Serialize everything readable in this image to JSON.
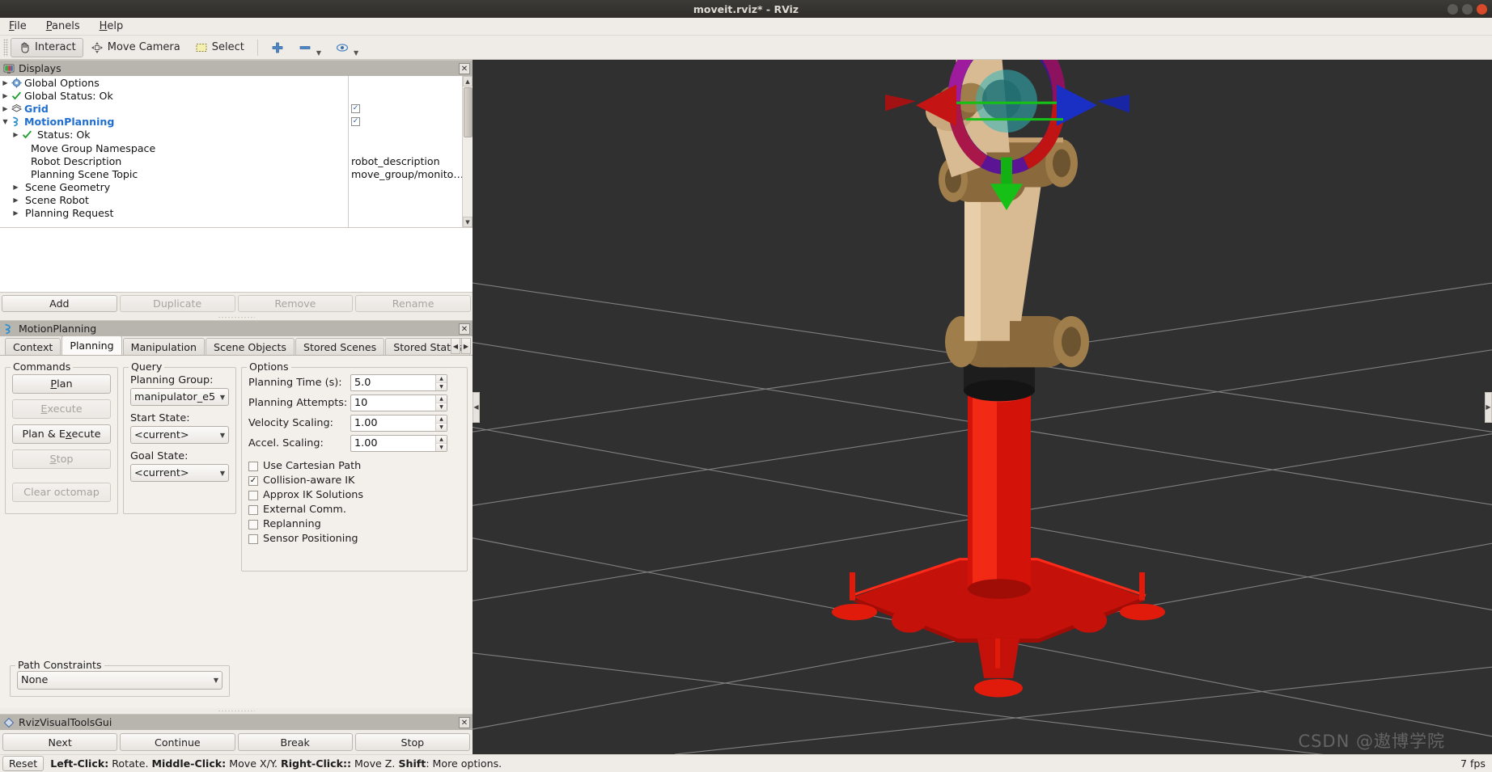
{
  "window": {
    "title": "moveit.rviz* - RViz",
    "buttons": [
      "minimize",
      "maximize",
      "close"
    ]
  },
  "menubar": {
    "items": [
      {
        "label": "File",
        "mnemonic": "F"
      },
      {
        "label": "Panels",
        "mnemonic": "P"
      },
      {
        "label": "Help",
        "mnemonic": "H"
      }
    ]
  },
  "toolbar": {
    "items": [
      {
        "label": "Interact",
        "icon": "hand-cursor-icon",
        "active": true
      },
      {
        "label": "Move Camera",
        "icon": "move-camera-icon",
        "active": false
      },
      {
        "label": "Select",
        "icon": "select-rect-icon",
        "active": false
      }
    ],
    "tools": [
      {
        "label": "",
        "icon": "plus-icon",
        "has_menu": false
      },
      {
        "label": "",
        "icon": "minus-icon",
        "has_menu": true
      },
      {
        "label": "",
        "icon": "eye-focus-icon",
        "has_menu": true
      }
    ]
  },
  "displays_panel": {
    "title": "Displays",
    "icon": "displays-monitor-icon",
    "close_icon": "close-icon",
    "rows": [
      {
        "label": "Global Options",
        "icon": "gear-icon",
        "arrow": "collapsed",
        "indent": 0,
        "bold": false,
        "value": "",
        "checkbox": null
      },
      {
        "label": "Global Status: Ok",
        "icon": "check-icon",
        "arrow": "collapsed",
        "indent": 0,
        "bold": false,
        "value": "",
        "checkbox": null
      },
      {
        "label": "Grid",
        "icon": "grid-icon",
        "arrow": "collapsed",
        "indent": 0,
        "bold": true,
        "value": "",
        "checkbox": true
      },
      {
        "label": "MotionPlanning",
        "icon": "motionplanning-icon",
        "arrow": "expanded",
        "indent": 0,
        "bold": true,
        "value": "",
        "checkbox": true
      },
      {
        "label": "Status: Ok",
        "icon": "check-icon",
        "arrow": "collapsed",
        "indent": 1,
        "bold": false,
        "value": "",
        "checkbox": null
      },
      {
        "label": "Move Group Namespace",
        "icon": "",
        "arrow": "none",
        "indent": 1,
        "bold": false,
        "value": "",
        "checkbox": null
      },
      {
        "label": "Robot Description",
        "icon": "",
        "arrow": "none",
        "indent": 1,
        "bold": false,
        "value": "robot_description",
        "checkbox": null
      },
      {
        "label": "Planning Scene Topic",
        "icon": "",
        "arrow": "none",
        "indent": 1,
        "bold": false,
        "value": "move_group/monito…",
        "checkbox": null
      },
      {
        "label": "Scene Geometry",
        "icon": "",
        "arrow": "collapsed",
        "indent": 1,
        "bold": false,
        "value": "",
        "checkbox": null
      },
      {
        "label": "Scene Robot",
        "icon": "",
        "arrow": "collapsed",
        "indent": 1,
        "bold": false,
        "value": "",
        "checkbox": null
      },
      {
        "label": "Planning Request",
        "icon": "",
        "arrow": "collapsed",
        "indent": 1,
        "bold": false,
        "value": "",
        "checkbox": null
      }
    ],
    "buttons": [
      {
        "label": "Add",
        "enabled": true
      },
      {
        "label": "Duplicate",
        "enabled": false
      },
      {
        "label": "Remove",
        "enabled": false
      },
      {
        "label": "Rename",
        "enabled": false
      }
    ]
  },
  "motion_planning_panel": {
    "title": "MotionPlanning",
    "icon": "motionplanning-icon",
    "close_icon": "close-icon",
    "tabs": [
      {
        "label": "Context",
        "selected": false
      },
      {
        "label": "Planning",
        "selected": true
      },
      {
        "label": "Manipulation",
        "selected": false
      },
      {
        "label": "Scene Objects",
        "selected": false
      },
      {
        "label": "Stored Scenes",
        "selected": false
      },
      {
        "label": "Stored States",
        "selected": false
      }
    ],
    "tab_nav": {
      "prev": "◀",
      "next": "▶"
    },
    "commands": {
      "title": "Commands",
      "buttons": [
        {
          "label": "Plan",
          "mnemonic": "P",
          "enabled": true
        },
        {
          "label": "Execute",
          "mnemonic": "E",
          "enabled": false
        },
        {
          "label": "Plan & Execute",
          "mnemonic": "x",
          "enabled": true
        },
        {
          "label": "Stop",
          "mnemonic": "S",
          "enabled": false
        },
        {
          "label": "Clear octomap",
          "mnemonic": "",
          "enabled": false
        }
      ]
    },
    "query": {
      "title": "Query",
      "fields": [
        {
          "label": "Planning Group:",
          "value": "manipulator_e5"
        },
        {
          "label": "Start State:",
          "value": "<current>"
        },
        {
          "label": "Goal State:",
          "value": "<current>"
        }
      ]
    },
    "options": {
      "title": "Options",
      "spinners": [
        {
          "label": "Planning Time (s):",
          "value": "5.0"
        },
        {
          "label": "Planning Attempts:",
          "value": "10"
        },
        {
          "label": "Velocity Scaling:",
          "value": "1.00"
        },
        {
          "label": "Accel. Scaling:",
          "value": "1.00"
        }
      ],
      "checkboxes": [
        {
          "label": "Use Cartesian Path",
          "checked": false
        },
        {
          "label": "Collision-aware IK",
          "checked": true
        },
        {
          "label": "Approx IK Solutions",
          "checked": false
        },
        {
          "label": "External Comm.",
          "checked": false
        },
        {
          "label": "Replanning",
          "checked": false
        },
        {
          "label": "Sensor Positioning",
          "checked": false
        }
      ]
    },
    "path_constraints": {
      "title": "Path Constraints",
      "value": "None"
    }
  },
  "rviz_visual_tools_panel": {
    "title": "RvizVisualToolsGui",
    "icon": "diamond-icon",
    "close_icon": "close-icon",
    "buttons": [
      {
        "label": "Next"
      },
      {
        "label": "Continue"
      },
      {
        "label": "Break"
      },
      {
        "label": "Stop"
      }
    ]
  },
  "statusbar": {
    "reset_label": "Reset",
    "hint_segments": [
      {
        "text": "Left-Click:",
        "bold": true
      },
      {
        "text": " Rotate. ",
        "bold": false
      },
      {
        "text": "Middle-Click:",
        "bold": true
      },
      {
        "text": " Move X/Y. ",
        "bold": false
      },
      {
        "text": "Right-Click::",
        "bold": true
      },
      {
        "text": " Move Z. ",
        "bold": false
      },
      {
        "text": "Shift",
        "bold": true
      },
      {
        "text": ": More options.",
        "bold": false
      }
    ],
    "fps": "7 fps"
  },
  "viewport": {
    "background_color": "#303030",
    "grid_color": "#9a9a9a",
    "watermark": "CSDN @遨博学院",
    "left_handle_icon": "chevron-left-icon",
    "right_handle_icon": "chevron-right-icon",
    "robot": {
      "arm_color": "#d8bb92",
      "joint_color": "#8a6a3d",
      "base_color": "#e01b0c",
      "marker_ring_colors": [
        "#d01414",
        "#1414d0"
      ],
      "marker_arrow_colors": {
        "z": "#13b013",
        "x": "#d01414",
        "y": "#1414d0"
      },
      "marker_sphere_color": "#2fb6bd"
    }
  }
}
